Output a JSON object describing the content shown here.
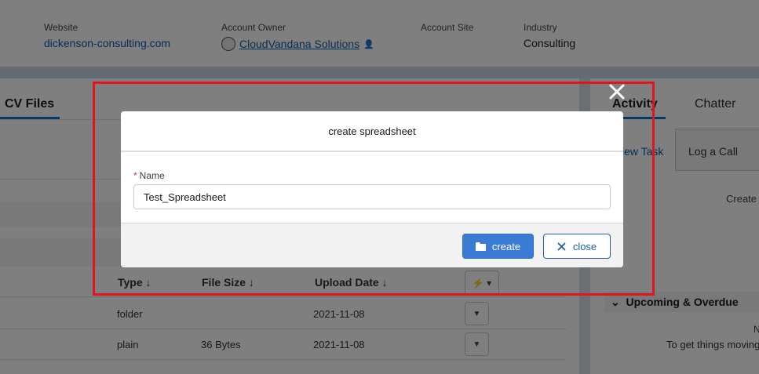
{
  "record_header": {
    "website": {
      "label": "Website",
      "value": "dickenson-consulting.com"
    },
    "owner": {
      "label": "Account Owner",
      "value": "CloudVandana Solutions"
    },
    "site": {
      "label": "Account Site",
      "value": ""
    },
    "industry": {
      "label": "Industry",
      "value": "Consulting"
    }
  },
  "left_panel": {
    "tab": "CV Files",
    "columns": [
      "Type",
      "File Size",
      "Upload Date"
    ],
    "rows": [
      {
        "type": "folder",
        "size": "",
        "date": "2021-11-08"
      },
      {
        "type": "plain",
        "size": "36 Bytes",
        "date": "2021-11-08"
      }
    ]
  },
  "right_panel": {
    "tabs": [
      "Activity",
      "Chatter"
    ],
    "new_task": "iew Task",
    "log_call": "Log a Call",
    "create": "Create",
    "upcoming": "Upcoming & Overdue",
    "n_text": "N",
    "get_things": "To get things moving"
  },
  "modal": {
    "title": "create spreadsheet",
    "field_label": "Name",
    "required_mark": "*",
    "field_value": "Test_Spreadsheet",
    "create_label": "create",
    "close_label": "close"
  },
  "colors": {
    "brand": "#0176d3",
    "primary_button": "#3a7bd5",
    "annotation": "#e3141b"
  }
}
